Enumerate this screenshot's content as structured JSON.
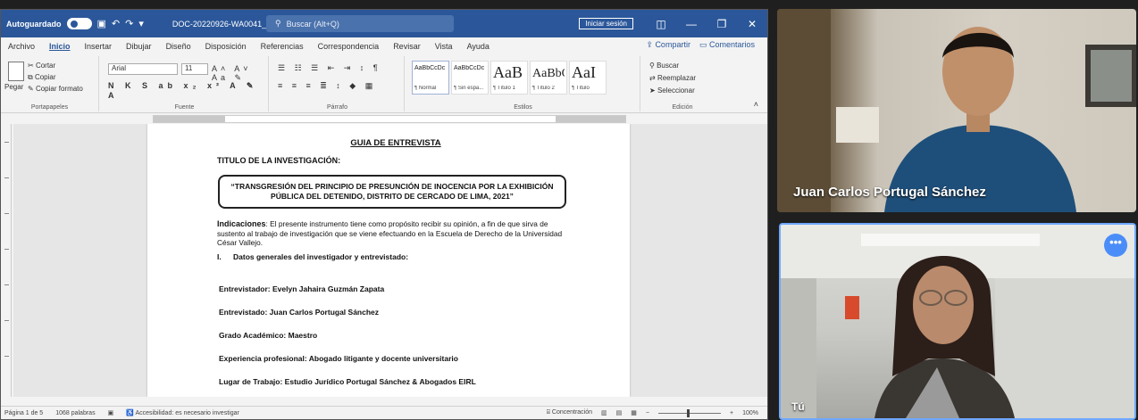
{
  "word": {
    "titlebar": {
      "autosave_label": "Autoguardado",
      "doc_title": "DOC-20220926-WA0041_ - Guardado",
      "search_placeholder": "Buscar (Alt+Q)",
      "signin": "Iniciar sesión"
    },
    "tabs": [
      "Archivo",
      "Inicio",
      "Insertar",
      "Dibujar",
      "Diseño",
      "Disposición",
      "Referencias",
      "Correspondencia",
      "Revisar",
      "Vista",
      "Ayuda"
    ],
    "active_tab": "Inicio",
    "share_label": "Compartir",
    "comments_label": "Comentarios",
    "clipboard": {
      "cut": "Cortar",
      "copy": "Copiar",
      "paste": "Pegar",
      "format_painter": "Copiar formato",
      "group_label": "Portapapeles"
    },
    "font": {
      "name": "Arial",
      "size": "11",
      "group_label": "Fuente"
    },
    "paragraph": {
      "group_label": "Párrafo"
    },
    "styles": {
      "group_label": "Estilos",
      "items": [
        {
          "sample": "AaBbCcDc",
          "name": "¶ Normal"
        },
        {
          "sample": "AaBbCcDc",
          "name": "¶ Sin espa..."
        },
        {
          "sample": "AaB",
          "name": "¶ Título 1"
        },
        {
          "sample": "AaBbC",
          "name": "¶ Título 2"
        },
        {
          "sample": "AaI",
          "name": "¶ Título"
        }
      ]
    },
    "editing": {
      "find": "Buscar",
      "replace": "Reemplazar",
      "select": "Seleccionar",
      "group_label": "Edición"
    },
    "document": {
      "title": "GUIA DE ENTREVISTA",
      "subtitle": "TITULO DE LA INVESTIGACIÓN:",
      "boxed_title": "“TRANSGRESIÓN DEL PRINCIPIO DE PRESUNCIÓN DE INOCENCIA POR LA EXHIBICIÓN PÚBLICA DEL DETENIDO, DISTRITO DE CERCADO DE LIMA, 2021”",
      "indications_label": "Indicaciones",
      "indications_text": ": El presente instrumento tiene como propósito recibir su opinión, a fin de que sirva de sustento al trabajo de investigación que se viene efectuando en la Escuela de Derecho de la Universidad César Vallejo.",
      "section_number": "I.",
      "section_title": "Datos generales del investigador y entrevistado:",
      "lines": [
        "Entrevistador: Evelyn Jahaira Guzmán Zapata",
        "Entrevistado: Juan Carlos Portugal Sánchez",
        "Grado Académico: Maestro",
        "Experiencia profesional: Abogado litigante y docente universitario",
        "Lugar de Trabajo: Estudio Jurídico Portugal Sánchez & Abogados EIRL"
      ]
    },
    "status": {
      "page": "Página 1 de 5",
      "words": "1068 palabras",
      "accessibility": "Accesibilidad: es necesario investigar",
      "focus": "Concentración",
      "zoom": "100%"
    }
  },
  "meeting": {
    "participant1_name": "Juan Carlos Portugal Sánchez",
    "participant2_name": "Tú",
    "more_label": "•••"
  }
}
